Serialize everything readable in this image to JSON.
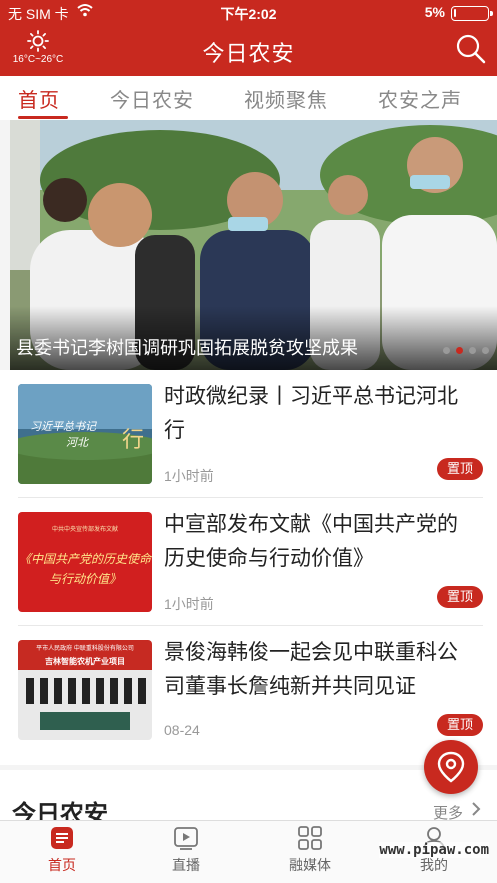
{
  "status_bar": {
    "carrier": "无 SIM 卡",
    "time": "下午2:02",
    "battery_percent": "5%",
    "battery_level": 0.05
  },
  "header": {
    "weather_icon": "sun-icon",
    "temperature": "16°C~26°C",
    "title": "今日农安",
    "search_icon": "search-icon"
  },
  "tabs": [
    {
      "label": "首页",
      "active": true
    },
    {
      "label": "今日农安",
      "active": false
    },
    {
      "label": "视频聚焦",
      "active": false
    },
    {
      "label": "农安之声",
      "active": false
    }
  ],
  "carousel": {
    "caption": "县委书记李树国调研巩固拓展脱贫攻坚成果",
    "dot_count": 4,
    "active_dot": 1
  },
  "news": [
    {
      "title": "时政微纪录丨习近平总书记河北行",
      "time": "1小时前",
      "badge": "置顶",
      "thumb_text": [
        "习近平总书记",
        "河北",
        "行"
      ]
    },
    {
      "title": "中宣部发布文献《中国共产党的历史使命与行动价值》",
      "time": "1小时前",
      "badge": "置顶",
      "thumb_text": [
        "中共中央宣传部发布文献",
        "《中国共产党的历史使命",
        "与行动价值》"
      ]
    },
    {
      "title": "景俊海韩俊一起会见中联重科公司董事长詹纯新并共同见证",
      "time": "08-24",
      "badge": "置顶",
      "thumb_text": [
        "平市人民政府   中联重科股份有限公司",
        "吉林智能农机产业项目"
      ]
    }
  ],
  "section": {
    "title": "今日农安",
    "more": "更多"
  },
  "bottom_nav": [
    {
      "label": "首页",
      "icon": "home-icon",
      "active": true
    },
    {
      "label": "直播",
      "icon": "live-icon",
      "active": false
    },
    {
      "label": "融媒体",
      "icon": "media-grid-icon",
      "active": false
    },
    {
      "label": "我的",
      "icon": "user-icon",
      "active": false
    }
  ],
  "watermark": "www.pipaw.com",
  "colors": {
    "brand_red": "#c8291f",
    "muted_text": "#999999"
  }
}
